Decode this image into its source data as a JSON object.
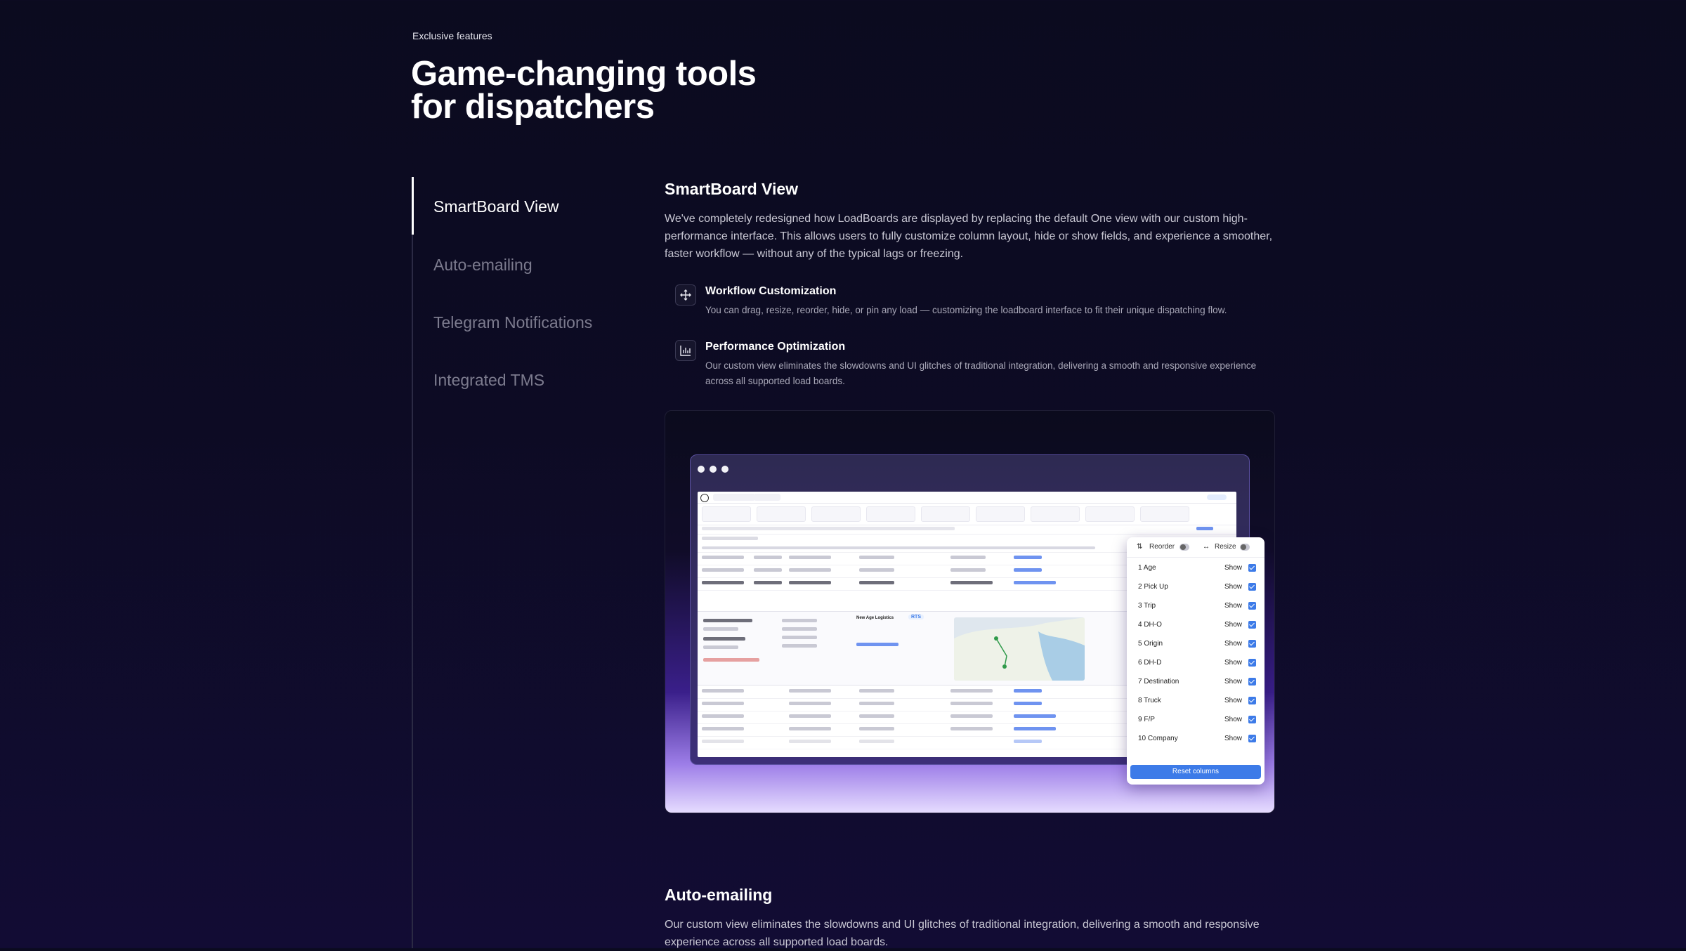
{
  "header": {
    "eyebrow": "Exclusive features",
    "title_line1": "Game-changing tools",
    "title_line2": "for dispatchers"
  },
  "nav": {
    "items": [
      {
        "label": "SmartBoard View",
        "active": true
      },
      {
        "label": "Auto-emailing",
        "active": false
      },
      {
        "label": "Telegram Notifications",
        "active": false
      },
      {
        "label": "Integrated TMS",
        "active": false
      }
    ]
  },
  "smartboard": {
    "title": "SmartBoard View",
    "body": "We've completely redesigned how LoadBoards are displayed by replacing the default One view with our custom high-performance interface. This allows users to fully customize column layout, hide or show fields, and experience a smoother, faster workflow — without any of the typical lags or freezing.",
    "features": [
      {
        "icon": "drag-arrows-icon",
        "title": "Workflow Customization",
        "desc": "You can drag, resize, reorder, hide, or pin any load — customizing the loadboard interface to fit their unique dispatching flow."
      },
      {
        "icon": "bar-chart-icon",
        "title": "Performance Optimization",
        "desc": "Our custom view eliminates the slowdowns and UI glitches of traditional integration, delivering a smooth and responsive experience across all supported load boards."
      }
    ]
  },
  "preview": {
    "column_panel": {
      "reorder_label": "Reorder",
      "resize_label": "Resize",
      "rows": [
        {
          "label": "1  Age",
          "show": "Show"
        },
        {
          "label": "2  Pick Up",
          "show": "Show"
        },
        {
          "label": "3  Trip",
          "show": "Show"
        },
        {
          "label": "4  DH-O",
          "show": "Show"
        },
        {
          "label": "5  Origin",
          "show": "Show"
        },
        {
          "label": "6  DH-D",
          "show": "Show"
        },
        {
          "label": "7  Destination",
          "show": "Show"
        },
        {
          "label": "8  Truck",
          "show": "Show"
        },
        {
          "label": "9  F/P",
          "show": "Show"
        },
        {
          "label": "10  Company",
          "show": "Show"
        }
      ],
      "reset_label": "Reset columns",
      "accent": "#3d7be8"
    },
    "detail": {
      "company": "New Age Logistics",
      "badge": "RTS"
    }
  },
  "autoemail": {
    "title": "Auto-emailing",
    "body": "Our custom view eliminates the slowdowns and UI glitches of traditional integration, delivering a smooth and responsive experience across all supported load boards."
  }
}
